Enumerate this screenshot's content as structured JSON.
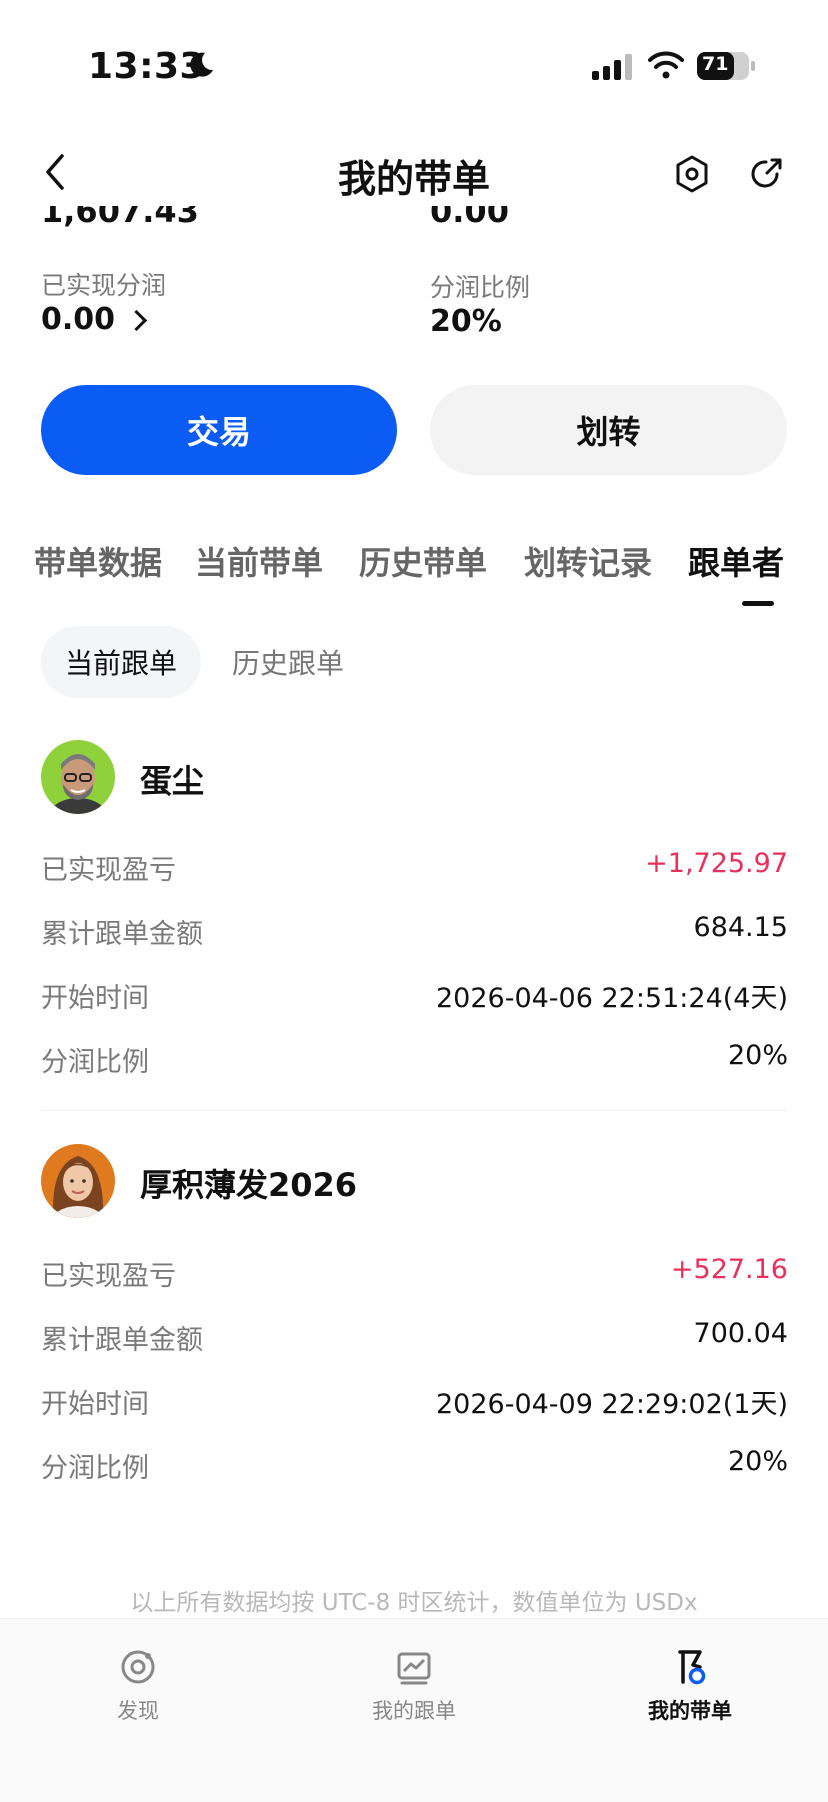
{
  "status_bar": {
    "time": "13:33",
    "battery": "71"
  },
  "header": {
    "title": "我的带单"
  },
  "summary": {
    "top_left_partial": "1,607.43",
    "top_right_partial": "0.00",
    "realized_label": "已实现分润",
    "realized_value": "0.00",
    "ratio_label": "分润比例",
    "ratio_value": "20%"
  },
  "actions": {
    "trade": "交易",
    "transfer": "划转"
  },
  "tabs": [
    {
      "label": "带单数据"
    },
    {
      "label": "当前带单"
    },
    {
      "label": "历史带单"
    },
    {
      "label": "划转记录"
    },
    {
      "label": "跟单者"
    }
  ],
  "subtabs": {
    "current": "当前跟单",
    "history": "历史跟单"
  },
  "followers": [
    {
      "name": "蛋尘",
      "rows": [
        {
          "label": "已实现盈亏",
          "value": "+1,725.97"
        },
        {
          "label": "累计跟单金额",
          "value": "684.15"
        },
        {
          "label": "开始时间",
          "value": "2026-04-06 22:51:24(4天)"
        },
        {
          "label": "分润比例",
          "value": "20%"
        }
      ]
    },
    {
      "name": "厚积薄发2026",
      "rows": [
        {
          "label": "已实现盈亏",
          "value": "+527.16"
        },
        {
          "label": "累计跟单金额",
          "value": "700.04"
        },
        {
          "label": "开始时间",
          "value": "2026-04-09 22:29:02(1天)"
        },
        {
          "label": "分润比例",
          "value": "20%"
        }
      ]
    }
  ],
  "footnote": "以上所有数据均按 UTC-8 时区统计，数值单位为 USDx",
  "bottom_nav": [
    {
      "label": "发现",
      "icon": "discover-icon"
    },
    {
      "label": "我的跟单",
      "icon": "chart-icon"
    },
    {
      "label": "我的带单",
      "icon": "flag-icon"
    }
  ],
  "colors": {
    "accent": "#0a5cf5",
    "positive": "#e8305a"
  }
}
